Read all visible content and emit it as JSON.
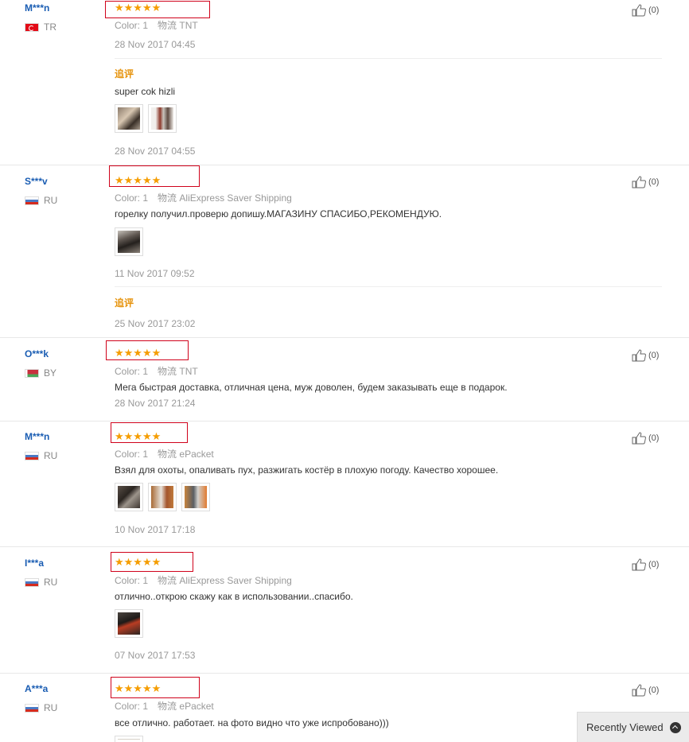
{
  "reviews": [
    {
      "user": "M***n",
      "country": "TR",
      "stars": "★★★★★",
      "color_label": "Color:",
      "color_value": "1",
      "shipping_label": "物流",
      "shipping_value": "TNT",
      "text": "",
      "date": "28 Nov 2017 04:45",
      "followup_label": "追评",
      "followup_text": "super cok hizli",
      "followup_date": "28 Nov 2017 04:55",
      "helpful": "(0)"
    },
    {
      "user": "S***v",
      "country": "RU",
      "stars": "★★★★★",
      "color_label": "Color:",
      "color_value": "1",
      "shipping_label": "物流",
      "shipping_value": "AliExpress Saver Shipping",
      "text": "горелку получил.проверю допишу.МАГАЗИНУ СПАСИБО,РЕКОМЕНДУЮ.",
      "date": "11 Nov 2017 09:52",
      "followup_label": "追评",
      "followup_date": "25 Nov 2017 23:02",
      "helpful": "(0)"
    },
    {
      "user": "O***k",
      "country": "BY",
      "stars": "★★★★★",
      "color_label": "Color:",
      "color_value": "1",
      "shipping_label": "物流",
      "shipping_value": "TNT",
      "text": "Мега быстрая доставка, отличная цена, муж доволен, будем заказывать еще в подарок.",
      "date": "28 Nov 2017 21:24",
      "helpful": "(0)"
    },
    {
      "user": "M***n",
      "country": "RU",
      "stars": "★★★★★",
      "color_label": "Color:",
      "color_value": "1",
      "shipping_label": "物流",
      "shipping_value": "ePacket",
      "text": "Взял для охоты, опаливать пух, разжигать костёр в плохую погоду. Качество хорошее.",
      "date": "10 Nov 2017 17:18",
      "helpful": "(0)"
    },
    {
      "user": "I***a",
      "country": "RU",
      "stars": "★★★★★",
      "color_label": "Color:",
      "color_value": "1",
      "shipping_label": "物流",
      "shipping_value": "AliExpress Saver Shipping",
      "text": "отлично..открою скажу как в использовании..спасибо.",
      "date": "07 Nov 2017 17:53",
      "helpful": "(0)"
    },
    {
      "user": "A***a",
      "country": "RU",
      "stars": "★★★★★",
      "color_label": "Color:",
      "color_value": "1",
      "shipping_label": "物流",
      "shipping_value": "ePacket",
      "text": "все отлично. работает. на фото видно что уже испробовано)))",
      "helpful": "(0)"
    }
  ],
  "recently_viewed": "Recently Viewed",
  "colors": {
    "star": "#f59d00",
    "user": "#1a5db3",
    "followup": "#e6920a",
    "highlight": "#d0021b"
  },
  "icons": {
    "helpful": "thumbs-up-icon",
    "recent_toggle": "chevron-up-icon"
  }
}
